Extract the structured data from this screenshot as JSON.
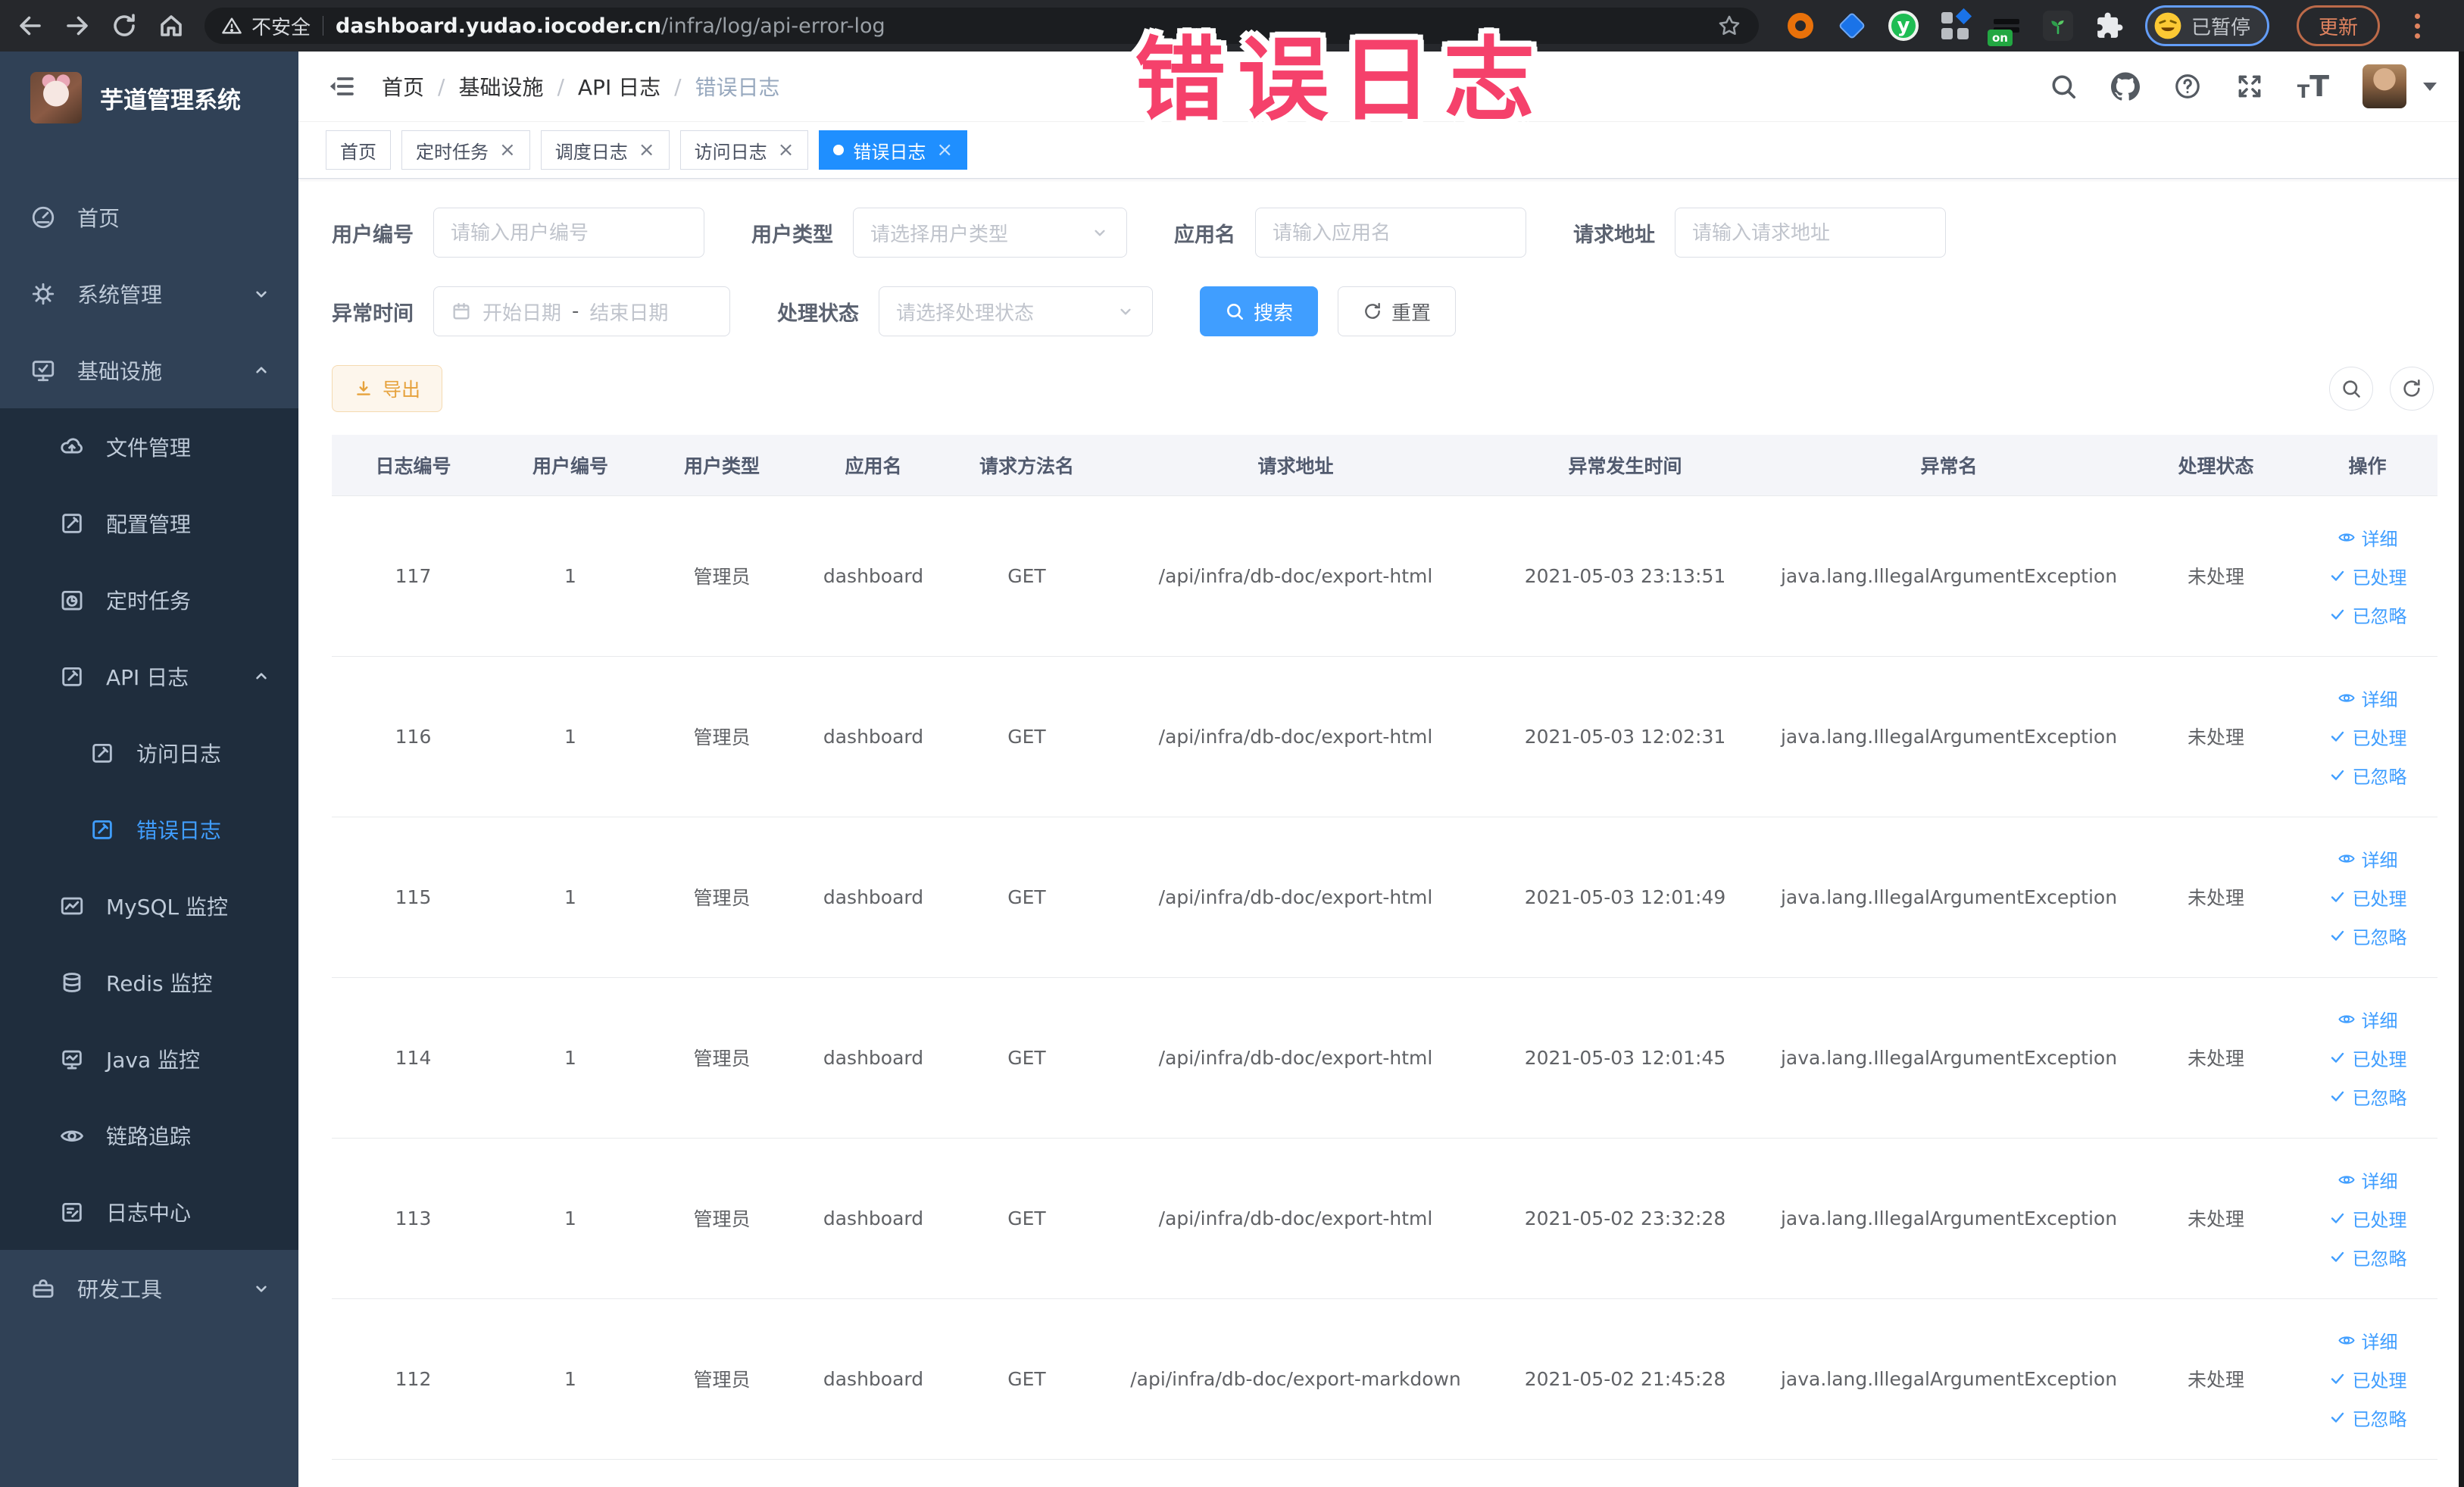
{
  "browser": {
    "security_label": "不安全",
    "url_domain": "dashboard.yudao.iocoder.cn",
    "url_path": "/infra/log/api-error-log",
    "paused_badge": "已暂停",
    "update_button": "更新",
    "extension_y_letter": "y",
    "extension_on_badge": "on"
  },
  "annotation": {
    "title": "错误日志",
    "color": "#f5416b"
  },
  "sidebar": {
    "logo_title": "芋道管理系统",
    "items": [
      {
        "label": "首页",
        "icon": "dashboard-icon"
      },
      {
        "label": "系统管理",
        "icon": "gear-icon",
        "expand": "down"
      },
      {
        "label": "基础设施",
        "icon": "monitor-check-icon",
        "expand": "up"
      },
      {
        "label": "文件管理",
        "icon": "cloud-upload-icon"
      },
      {
        "label": "配置管理",
        "icon": "edit-square-icon"
      },
      {
        "label": "定时任务",
        "icon": "timer-icon"
      },
      {
        "label": "API 日志",
        "icon": "log-edit-icon",
        "expand": "up"
      },
      {
        "label": "访问日志",
        "icon": "log-edit-icon"
      },
      {
        "label": "错误日志",
        "icon": "log-edit-icon",
        "active": true
      },
      {
        "label": "MySQL 监控",
        "icon": "chart-icon"
      },
      {
        "label": "Redis 监控",
        "icon": "database-icon"
      },
      {
        "label": "Java 监控",
        "icon": "screen-icon"
      },
      {
        "label": "链路追踪",
        "icon": "eye-icon"
      },
      {
        "label": "日志中心",
        "icon": "log-center-icon"
      },
      {
        "label": "研发工具",
        "icon": "toolbox-icon",
        "expand": "down"
      }
    ]
  },
  "breadcrumb": {
    "items": [
      "首页",
      "基础设施",
      "API 日志",
      "错误日志"
    ],
    "separator": "/"
  },
  "tabs": [
    {
      "label": "首页",
      "closable": false,
      "active": false
    },
    {
      "label": "定时任务",
      "closable": true,
      "active": false
    },
    {
      "label": "调度日志",
      "closable": true,
      "active": false
    },
    {
      "label": "访问日志",
      "closable": true,
      "active": false
    },
    {
      "label": "错误日志",
      "closable": true,
      "active": true
    }
  ],
  "filters": {
    "user_id": {
      "label": "用户编号",
      "placeholder": "请输入用户编号"
    },
    "user_type": {
      "label": "用户类型",
      "placeholder": "请选择用户类型"
    },
    "app_name": {
      "label": "应用名",
      "placeholder": "请输入应用名"
    },
    "request_url": {
      "label": "请求地址",
      "placeholder": "请输入请求地址"
    },
    "exception_time": {
      "label": "异常时间",
      "start_placeholder": "开始日期",
      "separator": "-",
      "end_placeholder": "结束日期"
    },
    "process_status": {
      "label": "处理状态",
      "placeholder": "请选择处理状态"
    },
    "search_button": "搜索",
    "reset_button": "重置"
  },
  "toolbar": {
    "export_button": "导出"
  },
  "table": {
    "columns": [
      "日志编号",
      "用户编号",
      "用户类型",
      "应用名",
      "请求方法名",
      "请求地址",
      "异常发生时间",
      "异常名",
      "处理状态",
      "操作"
    ],
    "row_actions": [
      "详细",
      "已处理",
      "已忽略"
    ],
    "row_action_icons": [
      "view-icon",
      "check-icon",
      "check-icon"
    ],
    "rows": [
      {
        "id": "117",
        "user_id": "1",
        "user_type": "管理员",
        "app": "dashboard",
        "method": "GET",
        "url": "/api/infra/db-doc/export-html",
        "time": "2021-05-03 23:13:51",
        "exception": "java.lang.IllegalArgumentException",
        "status": "未处理"
      },
      {
        "id": "116",
        "user_id": "1",
        "user_type": "管理员",
        "app": "dashboard",
        "method": "GET",
        "url": "/api/infra/db-doc/export-html",
        "time": "2021-05-03 12:02:31",
        "exception": "java.lang.IllegalArgumentException",
        "status": "未处理"
      },
      {
        "id": "115",
        "user_id": "1",
        "user_type": "管理员",
        "app": "dashboard",
        "method": "GET",
        "url": "/api/infra/db-doc/export-html",
        "time": "2021-05-03 12:01:49",
        "exception": "java.lang.IllegalArgumentException",
        "status": "未处理"
      },
      {
        "id": "114",
        "user_id": "1",
        "user_type": "管理员",
        "app": "dashboard",
        "method": "GET",
        "url": "/api/infra/db-doc/export-html",
        "time": "2021-05-03 12:01:45",
        "exception": "java.lang.IllegalArgumentException",
        "status": "未处理"
      },
      {
        "id": "113",
        "user_id": "1",
        "user_type": "管理员",
        "app": "dashboard",
        "method": "GET",
        "url": "/api/infra/db-doc/export-html",
        "time": "2021-05-02 23:32:28",
        "exception": "java.lang.IllegalArgumentException",
        "status": "未处理"
      },
      {
        "id": "112",
        "user_id": "1",
        "user_type": "管理员",
        "app": "dashboard",
        "method": "GET",
        "url": "/api/infra/db-doc/export-markdown",
        "time": "2021-05-02 21:45:28",
        "exception": "java.lang.IllegalArgumentException",
        "status": "未处理"
      }
    ]
  },
  "colors": {
    "accent": "#409eff",
    "active_tab": "#1f8fff",
    "warning": "#e6a23c",
    "sidebar_bg": "#304156",
    "sidebar_child_bg": "#1f2d3d"
  }
}
